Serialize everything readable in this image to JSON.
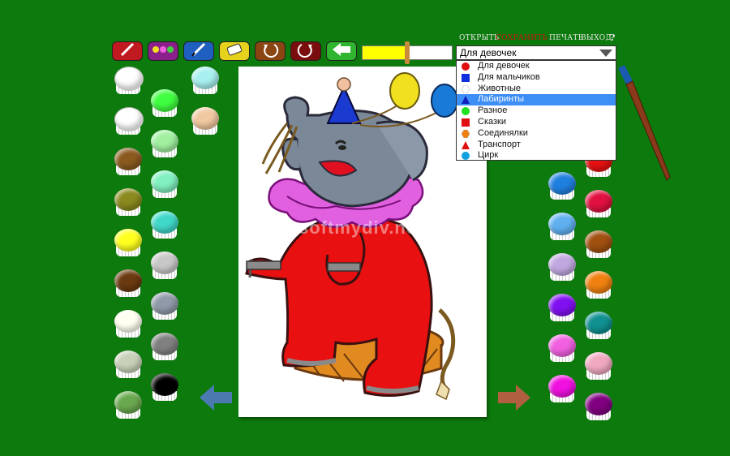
{
  "toolbar": {
    "tools": [
      {
        "name": "brush-tool",
        "color": "#c0191f",
        "icon": "brush-icon"
      },
      {
        "name": "pattern-tool",
        "color": "#8b1f8b",
        "icon": "dots-icon"
      },
      {
        "name": "pencil-tool",
        "color": "#1f5fbf",
        "icon": "pencil-icon"
      },
      {
        "name": "eraser-tool",
        "color": "#e6d21c",
        "icon": "eraser-icon"
      },
      {
        "name": "undo-tool",
        "color": "#8a4513",
        "icon": "undo-icon"
      },
      {
        "name": "redo-tool",
        "color": "#7a0e0e",
        "icon": "redo-icon"
      },
      {
        "name": "back-tool",
        "color": "#2fb52f",
        "icon": "back-arrow-icon"
      }
    ],
    "brush_size_fraction": 0.5
  },
  "top_menu": {
    "open": "ОТКРЫТЬ",
    "save": "СОХРАНИТЬ",
    "print": "ПЕЧАТЬ",
    "exit": "ВЫХОД",
    "help": "?"
  },
  "category_select": {
    "selected": "Для девочек",
    "options": [
      {
        "label": "Для девочек",
        "color": "#e01010",
        "shape": "circle"
      },
      {
        "label": "Для мальчиков",
        "color": "#1030e0",
        "shape": "square"
      },
      {
        "label": "Животные",
        "color": "#ffffff",
        "shape": "hexagon"
      },
      {
        "label": "Лабиринты",
        "color": "#1020c0",
        "shape": "triangle",
        "highlighted": true
      },
      {
        "label": "Разное",
        "color": "#20e020",
        "shape": "circle"
      },
      {
        "label": "Сказки",
        "color": "#e01010",
        "shape": "square"
      },
      {
        "label": "Соединялки",
        "color": "#f08010",
        "shape": "hexagon"
      },
      {
        "label": "Транспорт",
        "color": "#e01010",
        "shape": "triangle"
      },
      {
        "label": "Цирк",
        "color": "#10a0e0",
        "shape": "circle"
      }
    ]
  },
  "palette_left": [
    [
      "#ffffff",
      "#ffffff",
      "#8a5a1f",
      "#8a8a1f",
      "#ffff20",
      "#6b3a10",
      "#fffff0",
      "#c8d0b8",
      "#6aa84f"
    ],
    [
      "#40ff40",
      "#a0f0a0",
      "#80f0c0",
      "#40d8c8",
      "#c8c8c8",
      "#909aa8",
      "#808080",
      "#000000"
    ],
    [
      "#a8f0f0",
      "#f0c8a0"
    ]
  ],
  "palette_right": [
    [
      "#2080e0",
      "#60b0f0",
      "#c0a8e0",
      "#8010f0",
      "#f060e0",
      "#f010e0"
    ],
    [
      "#e81010",
      "#e01040",
      "#a05010",
      "#f08010",
      "#109090",
      "#f0a8c0",
      "#800080"
    ]
  ],
  "watermark": "softmydiv.net"
}
